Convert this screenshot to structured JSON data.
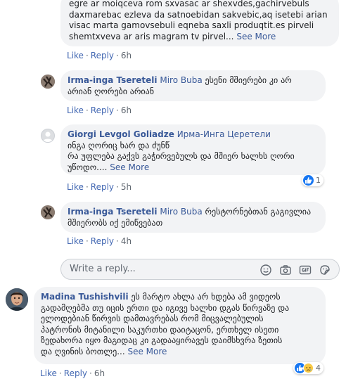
{
  "comment0": {
    "lines": [
      "egre ar moiqceva rom sxvasac ar shexvdes,gachirvebuls",
      "daxmarebac ezleva da satnoebidan sakvebic,aq isetebi arian",
      "visac marta gamovsebuli eqneba saxli produqtit.es pirveli",
      "shemtxveva ar aris magram tv pirvel..."
    ],
    "see_more": "See More",
    "like": "Like",
    "reply": "Reply",
    "time": "6h"
  },
  "comment1": {
    "author": "Irma-inga Tsereteli",
    "tag": "Miro Buba",
    "text_1": " ესენი მშიერები კი არ",
    "text_2": "არიან ღორები არიან",
    "like": "Like",
    "reply": "Reply",
    "time": "6h"
  },
  "comment2": {
    "author": "Giorgi Levgol Goliadze",
    "tag": "Ирма-Инга Церетели",
    "lines": [
      "ინგა ღორიც ხარ და ძუნწ",
      "რა უფლება გაქვს გაჭირვებულს და მშიერ ხალხს ღორი",
      "უწოდო...."
    ],
    "see_more": "See More",
    "like": "Like",
    "reply": "Reply",
    "time": "5h",
    "reaction_count": "1"
  },
  "comment3": {
    "author": "Irma-inga Tsereteli",
    "tag": "Miro Buba",
    "text_1": " რესტორნებთან გაგივლია",
    "text_2": "მშიერობს იქ ემიწვებათ",
    "like": "Like",
    "reply": "Reply",
    "time": "4h"
  },
  "reply_box": {
    "placeholder": "Write a reply..."
  },
  "comment4": {
    "author": "Madina Tushishvili",
    "text_1": " ეს მარტო ახლა არ ხდება ამ ვიდეოს",
    "lines": [
      "გადამღებმა თუ იცის ერთი და იგივე ხალხი დგას წირვაზე და",
      "ელოდებიან წირვის დამთავრებას რომ მიცვალებულის",
      "პატრონის მიტანილი საკურთხი დაიტაცონ, ერთხელ ისეთი",
      "ზედახორა იყო მაგიდაც კი გადააყირავეს დაიმსხვრა ზეთის",
      "და ღვინის ბოთლე..."
    ],
    "see_more": "See More",
    "like": "Like",
    "reply": "Reply",
    "time": "6h",
    "reaction_count": "4"
  },
  "colors": {
    "link": "#385898",
    "action": "#4267b2",
    "bubble": "#f2f3f5",
    "meta": "#606770"
  }
}
